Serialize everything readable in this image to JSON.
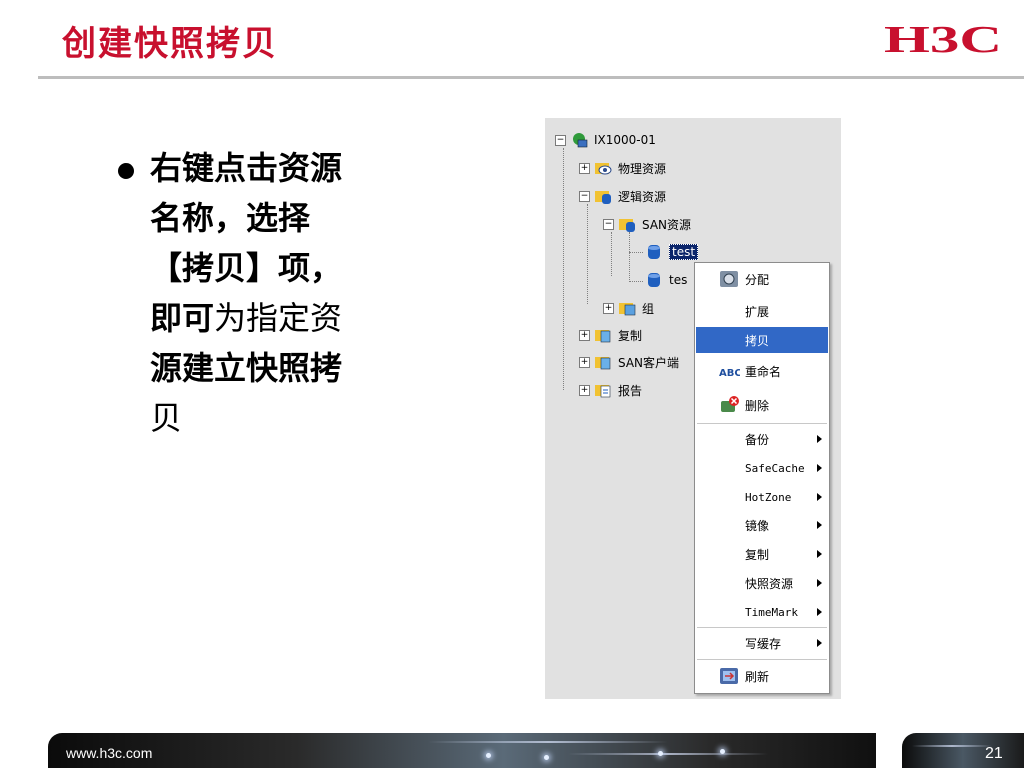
{
  "slide": {
    "title": "创建快照拷贝",
    "page_number": "21",
    "footer_url": "www.h3c.com",
    "brand_color": "#c8102e",
    "logo_icon": "h3c-logo"
  },
  "bullet": {
    "line1": "右键点击资源",
    "line2": "名称，选择",
    "line3": "【拷贝】项，",
    "line4a": "即可",
    "line4b": "为指定资",
    "line5": "源建立快照拷",
    "line6": "贝"
  },
  "tree": {
    "root": "IX1000-01",
    "items": [
      {
        "label": "物理资源",
        "icon": "physical-resource-icon"
      },
      {
        "label": "逻辑资源",
        "icon": "logical-resource-icon"
      },
      {
        "label": "SAN资源",
        "icon": "san-resource-icon"
      },
      {
        "label": "test",
        "icon": "disk-icon",
        "selected": true
      },
      {
        "label": "tes",
        "icon": "disk-icon"
      },
      {
        "label": "组",
        "icon": "group-icon"
      },
      {
        "label": "复制",
        "icon": "replication-icon"
      },
      {
        "label": "SAN客户端",
        "icon": "san-client-icon"
      },
      {
        "label": "报告",
        "icon": "report-icon"
      }
    ]
  },
  "context_menu": {
    "items": [
      {
        "label": "分配",
        "icon": "assign-icon"
      },
      {
        "label": "扩展"
      },
      {
        "label": "拷贝",
        "highlighted": true
      },
      {
        "label": "重命名",
        "icon": "rename-icon"
      },
      {
        "label": "删除",
        "icon": "delete-icon"
      },
      {
        "label": "备份",
        "submenu": true
      },
      {
        "label": "SafeCache",
        "submenu": true
      },
      {
        "label": "HotZone",
        "submenu": true
      },
      {
        "label": "镜像",
        "submenu": true
      },
      {
        "label": "复制",
        "submenu": true
      },
      {
        "label": "快照资源",
        "submenu": true
      },
      {
        "label": "TimeMark",
        "submenu": true
      },
      {
        "label": "写缓存",
        "submenu": true
      },
      {
        "label": "刷新",
        "icon": "refresh-icon"
      }
    ]
  }
}
